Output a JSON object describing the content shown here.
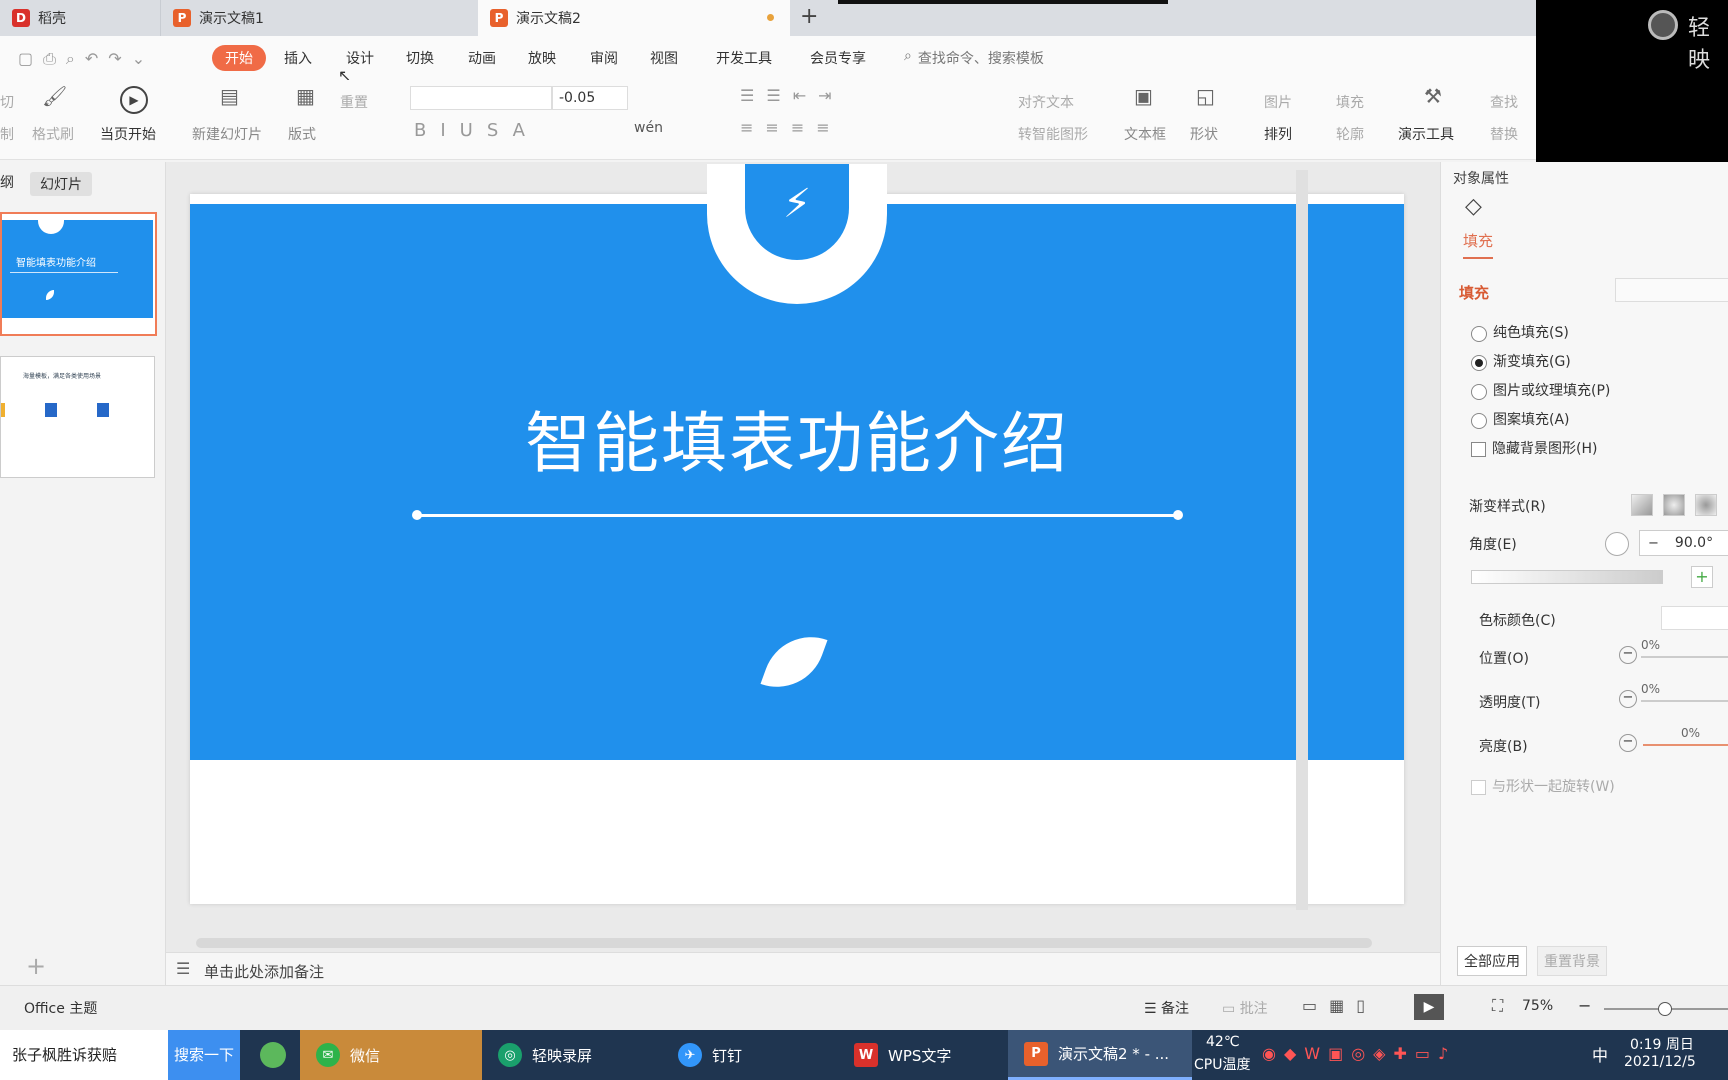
{
  "tabs": [
    {
      "label": "稻壳",
      "color": "#d9312b",
      "icon_char": "D"
    },
    {
      "label": "演示文稿1",
      "color": "#e8612c",
      "icon_char": "P"
    },
    {
      "label": "演示文稿2",
      "color": "#e8612c",
      "icon_char": "P",
      "active": true
    }
  ],
  "new_tab_label": "+",
  "camera_label": "轻映",
  "menu": {
    "start": "开始",
    "items": [
      "插入",
      "设计",
      "切换",
      "动画",
      "放映",
      "审阅",
      "视图",
      "开发工具",
      "会员专享"
    ],
    "search_placeholder": "查找命令、搜索模板"
  },
  "ribbon": {
    "cut": "切",
    "copy": "制",
    "format_painter": "格式刷",
    "from_current": "当页开始",
    "new_slide": "新建幻灯片",
    "layout": "版式",
    "reset": "重置",
    "font_size": "-0.05",
    "wen": "wén",
    "align_text": "对齐文本",
    "smart_shape": "转智能图形",
    "textbox": "文本框",
    "shape": "形状",
    "picture": "图片",
    "fill": "填充",
    "arrange": "排列",
    "outline": "轮廓",
    "tools": "演示工具",
    "find": "查找",
    "replace": "替换"
  },
  "left_panel": {
    "tab_outline": "纲",
    "tab_slides": "幻灯片",
    "thumb1_title": "智能填表功能介绍",
    "thumb2_title": "海量模板，满足各类使用场景"
  },
  "slide": {
    "title": "智能填表功能介绍",
    "bg_color": "#2090ec"
  },
  "notes_placeholder": "单击此处添加备注",
  "right_panel": {
    "header": "对象属性",
    "fill_tab": "填充",
    "fill_section": "填充",
    "options": [
      {
        "label": "纯色填充(S)",
        "selected": false
      },
      {
        "label": "渐变填充(G)",
        "selected": true
      },
      {
        "label": "图片或纹理填充(P)",
        "selected": false
      },
      {
        "label": "图案填充(A)",
        "selected": false
      }
    ],
    "hide_bg": "隐藏背景图形(H)",
    "gradient_style": "渐变样式(R)",
    "angle_label": "角度(E)",
    "angle_value": "90.0°",
    "stop_color": "色标颜色(C)",
    "position_label": "位置(O)",
    "position_value": "0%",
    "transparency_label": "透明度(T)",
    "transparency_value": "0%",
    "brightness_label": "亮度(B)",
    "brightness_value": "0%",
    "rotate_with_shape": "与形状一起旋转(W)",
    "apply_all": "全部应用",
    "reset_bg": "重置背景"
  },
  "status": {
    "theme": "Office 主题",
    "notes": "备注",
    "comments": "批注",
    "zoom": "75%"
  },
  "taskbar": {
    "search_text": "张子枫胜诉获赔",
    "search_button": "搜索一下",
    "apps": [
      {
        "label": "微信",
        "color": "#2db34a",
        "active": true
      },
      {
        "label": "轻映录屏",
        "color": "#1aa06c"
      },
      {
        "label": "钉钉",
        "color": "#3296fa"
      },
      {
        "label": "WPS文字",
        "color": "#d9312b"
      },
      {
        "label": "演示文稿2 * - ...",
        "color": "#e8612c",
        "active": true
      }
    ],
    "temp": "42℃",
    "cpu": "CPU温度",
    "ime": "中",
    "time": "0:19 周日",
    "date": "2021/12/5"
  }
}
